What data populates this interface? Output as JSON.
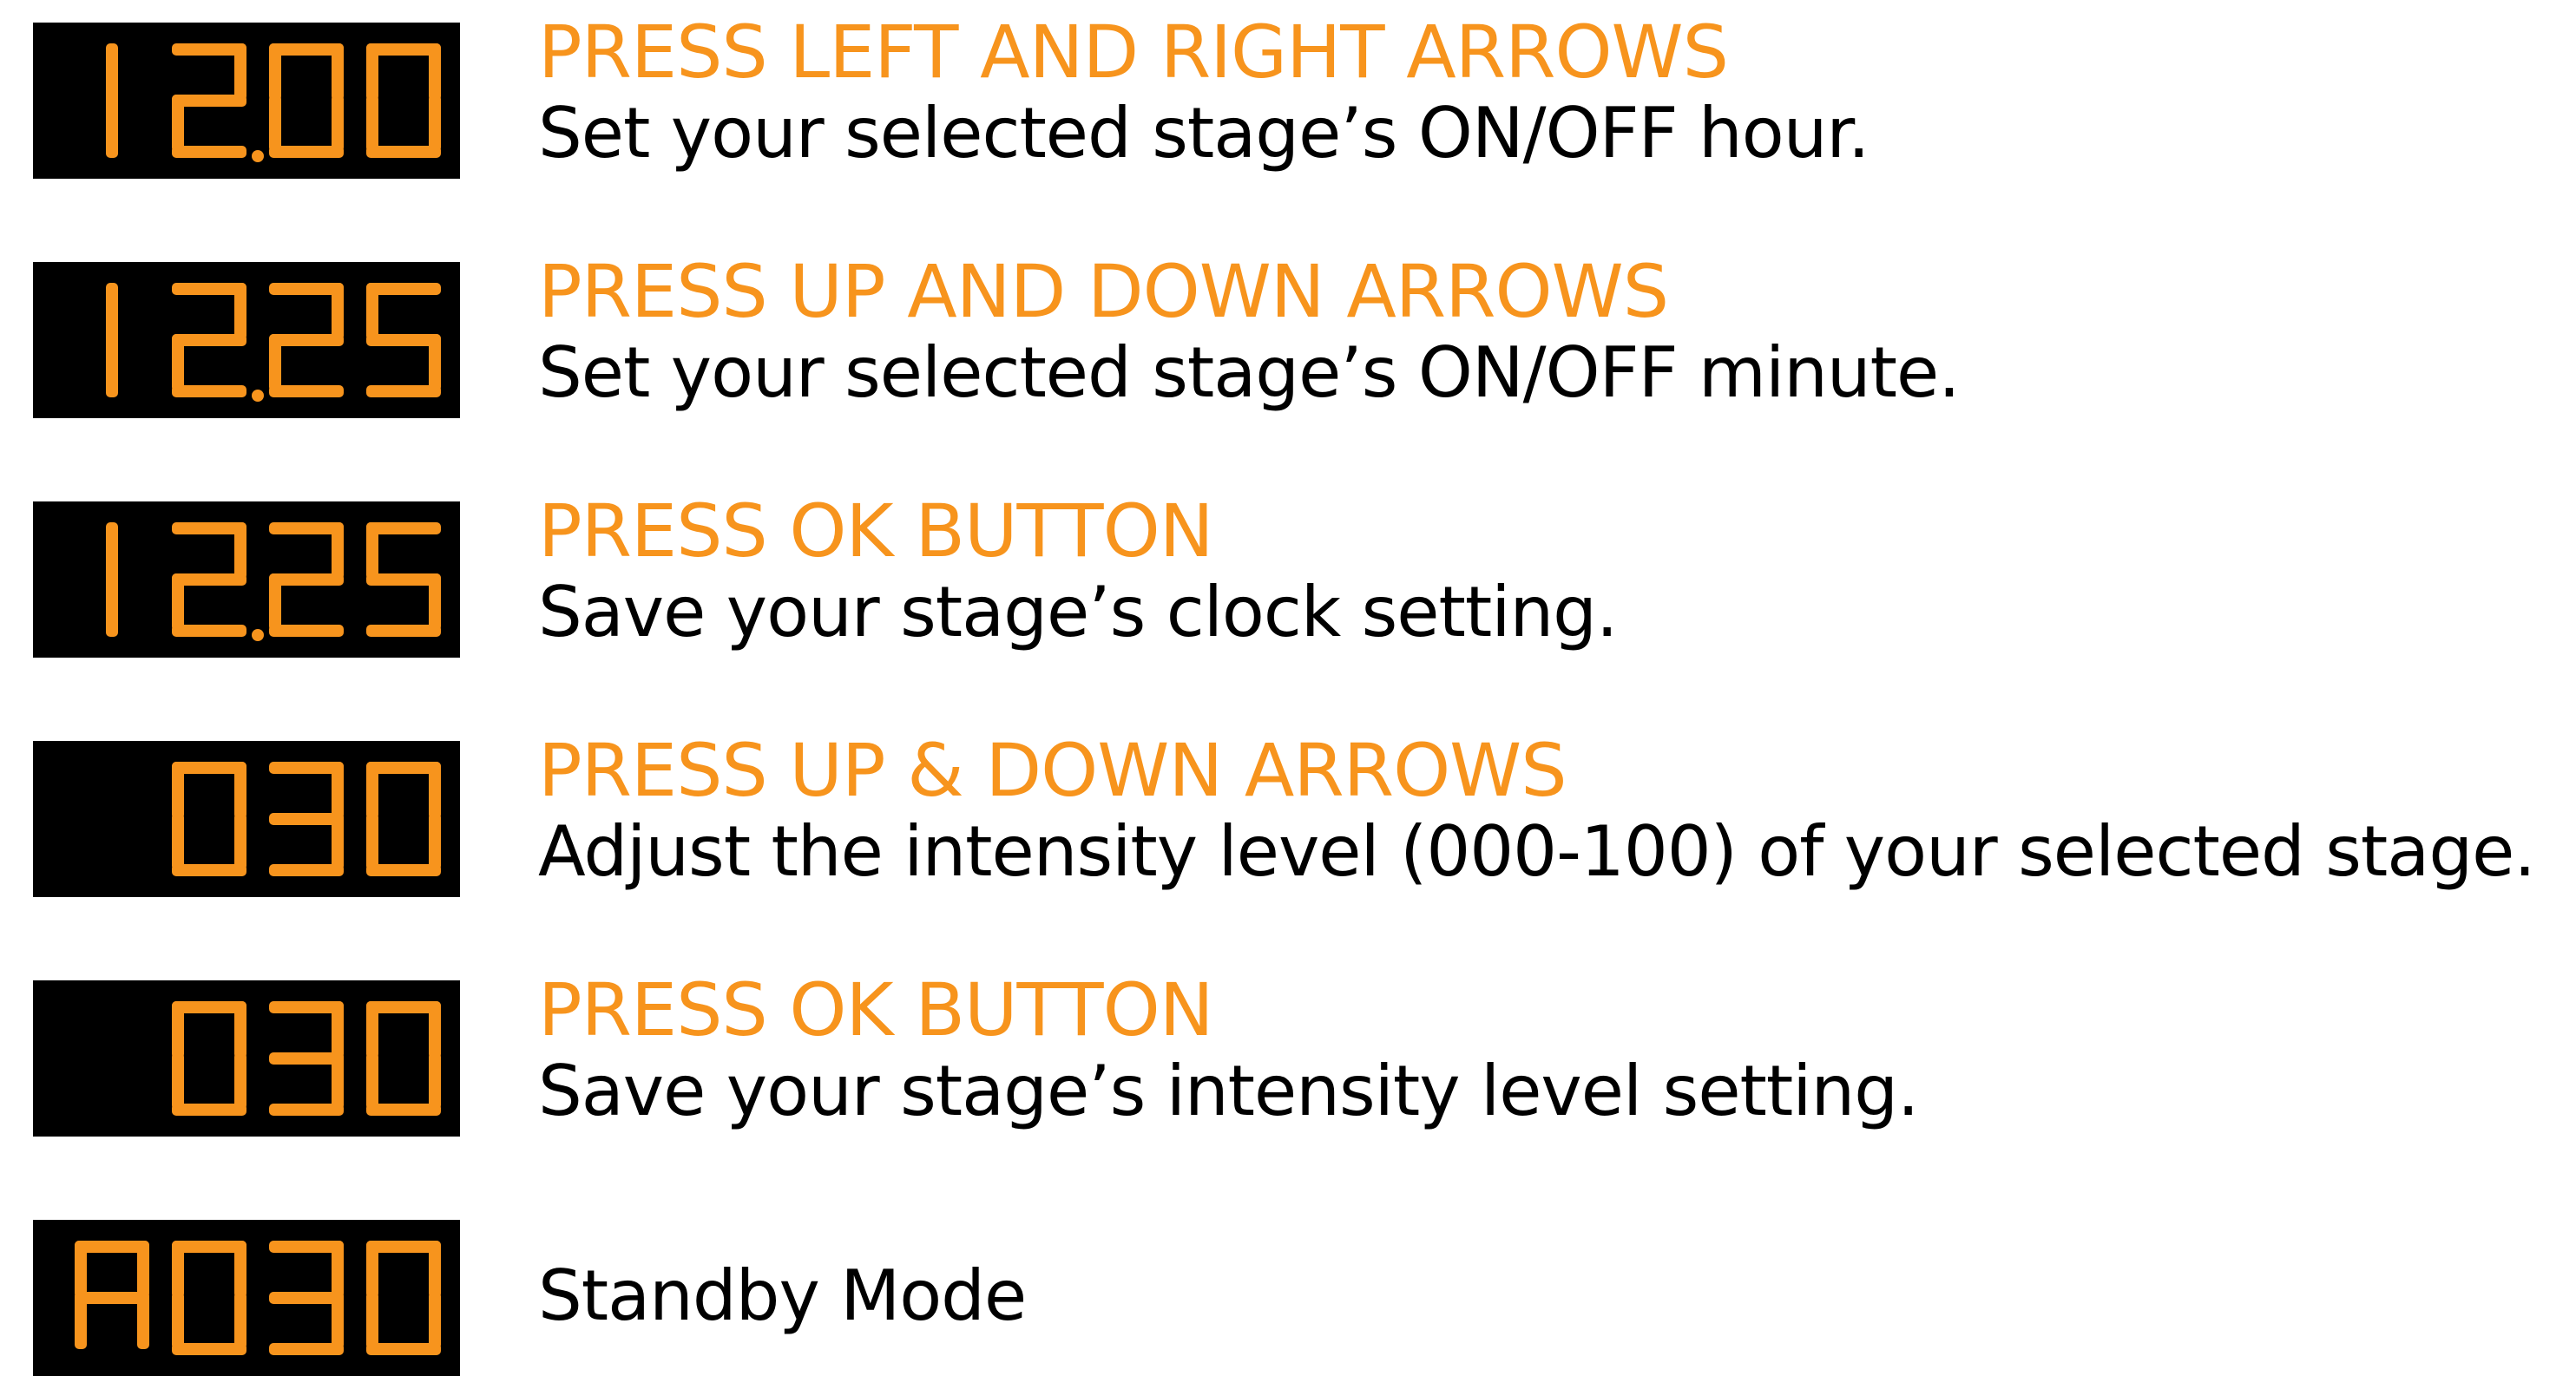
{
  "colors": {
    "accent": "#f7941d",
    "lcd_background": "#000000",
    "text": "#000000",
    "page_background": "#ffffff"
  },
  "steps": [
    {
      "display": "12.00",
      "heading": "PRESS LEFT AND RIGHT ARROWS",
      "description": "Set your selected stage’s ON/OFF hour."
    },
    {
      "display": "12.25",
      "heading": "PRESS UP AND DOWN ARROWS",
      "description": "Set your selected stage’s ON/OFF minute."
    },
    {
      "display": "12.25",
      "heading": "PRESS OK BUTTON",
      "description": "Save your stage’s clock setting."
    },
    {
      "display": "030",
      "heading": "PRESS UP & DOWN ARROWS",
      "description": "Adjust the intensity level (000-100) of your selected stage."
    },
    {
      "display": "030",
      "heading": "PRESS OK BUTTON",
      "description": "Save your stage’s intensity level setting."
    },
    {
      "display": "A030",
      "heading": "",
      "description": "Standby Mode"
    }
  ]
}
